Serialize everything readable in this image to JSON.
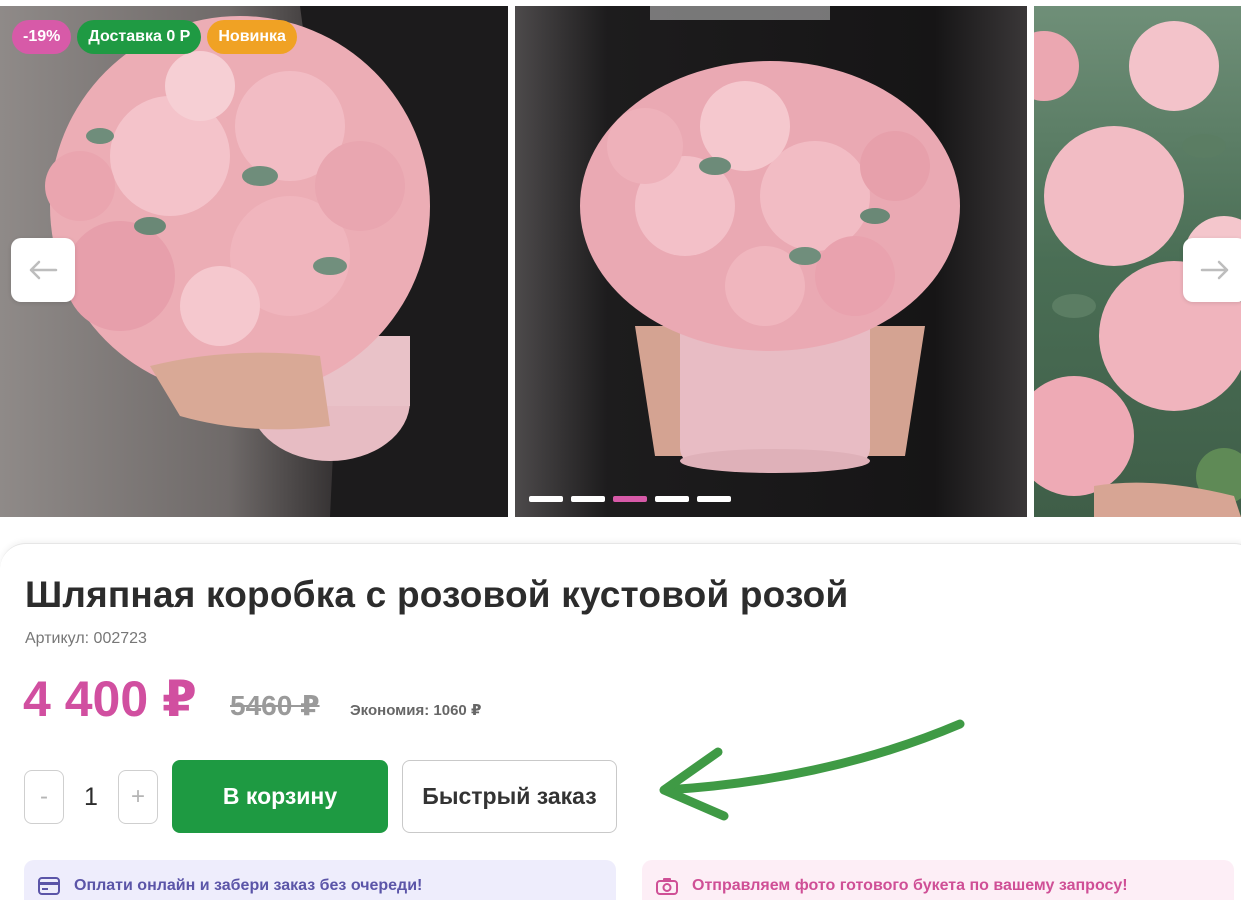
{
  "gallery": {
    "badges": {
      "discount": "-19%",
      "delivery": "Доставка 0 Р",
      "new": "Новинка"
    },
    "prev_icon": "arrow-left-icon",
    "next_icon": "arrow-right-icon",
    "slides_total": 5,
    "active_slide": 3
  },
  "product": {
    "title": "Шляпная коробка с розовой кустовой розой",
    "sku": "Артикул: 002723",
    "price": "4 400 ₽",
    "old_price": "5460 ₽",
    "saving": "Экономия: 1060 ₽"
  },
  "actions": {
    "minus": "-",
    "quantity": "1",
    "plus": "+",
    "add_to_cart": "В корзину",
    "quick_order": "Быстрый заказ"
  },
  "info": {
    "online": "Оплати онлайн и забери заказ без очереди!",
    "online_icon": "card-icon",
    "photo": "Отправляем фото готового букета по вашему запросу!",
    "photo_icon": "camera-icon"
  },
  "colors": {
    "accent_pink": "#d14fa0",
    "cart_green": "#1e9a42",
    "badge_orange": "#f0a224"
  }
}
